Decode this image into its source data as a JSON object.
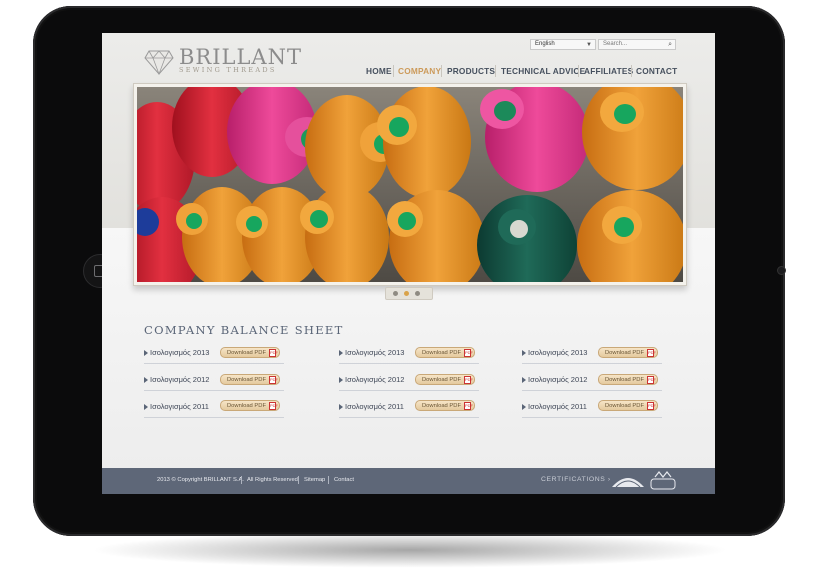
{
  "site": {
    "brand_name": "BRILLANT",
    "brand_tagline": "SEWING THREADS",
    "language_selected": "English",
    "search_placeholder": "Search..."
  },
  "nav": {
    "items": [
      {
        "label": "HOME",
        "active": false
      },
      {
        "label": "COMPANY",
        "active": true
      },
      {
        "label": "PRODUCTS",
        "active": false
      },
      {
        "label": "TECHNICAL ADVICE",
        "active": false
      },
      {
        "label": "AFFILIATES",
        "active": false
      },
      {
        "label": "CONTACT",
        "active": false
      }
    ]
  },
  "slider": {
    "slide_count": 3,
    "active_slide": 2
  },
  "balance_sheet": {
    "title": "COMPANY BALANCE SHEET",
    "download_label": "Download PDF",
    "pdf_icon_text": "PDF",
    "columns": [
      {
        "entries": [
          {
            "label": "Ισολογισμός 2013"
          },
          {
            "label": "Ισολογισμός 2012"
          },
          {
            "label": "Ισολογισμός 2011"
          }
        ]
      },
      {
        "entries": [
          {
            "label": "Ισολογισμός 2013"
          },
          {
            "label": "Ισολογισμός 2012"
          },
          {
            "label": "Ισολογισμός 2011"
          }
        ]
      },
      {
        "entries": [
          {
            "label": "Ισολογισμός 2013"
          },
          {
            "label": "Ισολογισμός 2012"
          },
          {
            "label": "Ισολογισμός 2011"
          }
        ]
      }
    ]
  },
  "footer": {
    "copyright": "2013 © Copyright BRILLANT S.A.",
    "rights": "All Rights Reserved",
    "sitemap": "Sitemap",
    "contact": "Contact",
    "certifications": "CERTIFICATIONS ›"
  },
  "colors": {
    "nav_text": "#46505e",
    "nav_active": "#cc9a5a",
    "footer_bg": "#5e6778",
    "button_bg": "#e4c99e"
  },
  "icons": [
    "diamond-logo-icon",
    "chevron-down-icon",
    "search-icon",
    "pdf-icon",
    "bullet-arrow-icon",
    "certification-logo-icon",
    "tuv-logo-icon"
  ]
}
